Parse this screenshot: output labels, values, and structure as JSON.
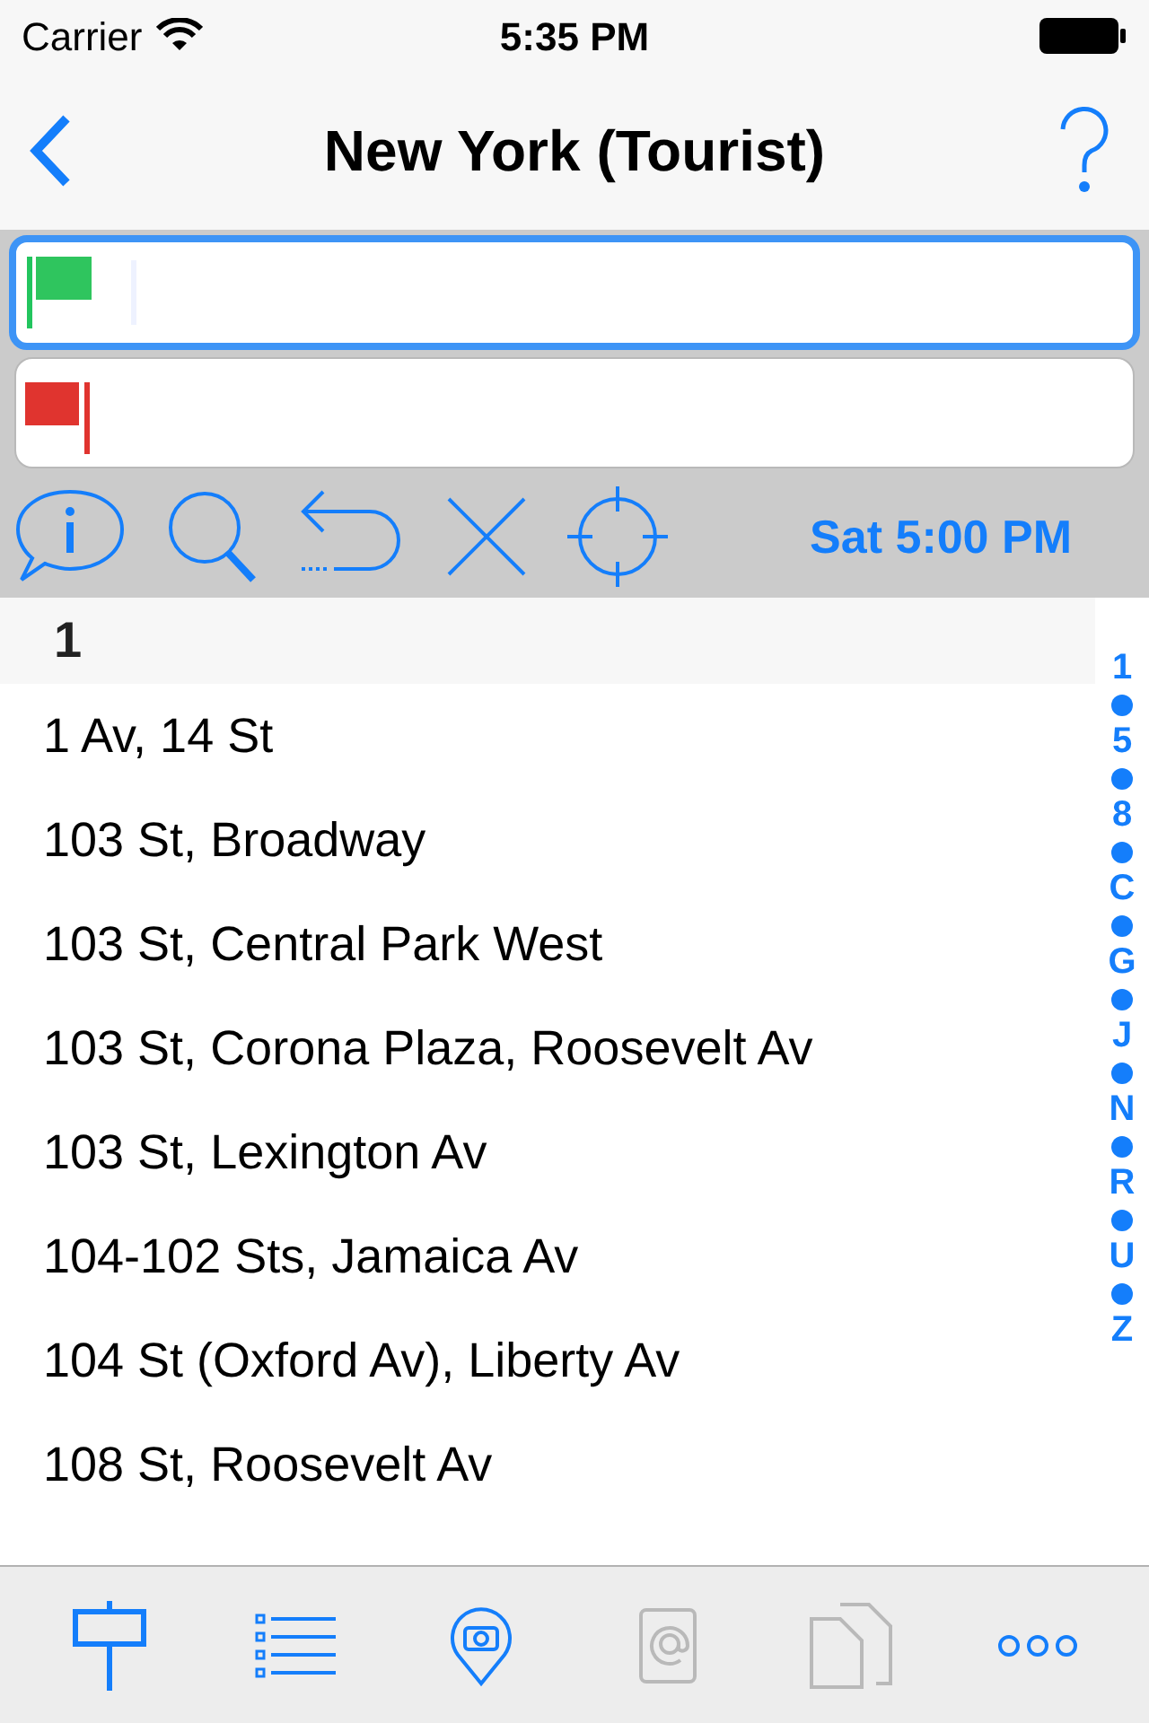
{
  "status_bar": {
    "carrier": "Carrier",
    "time": "5:35 PM"
  },
  "nav": {
    "title": "New York (Tourist)"
  },
  "fields": [
    {
      "kind": "start",
      "focused": true
    },
    {
      "kind": "end",
      "focused": false
    }
  ],
  "toolbar": {
    "time": "Sat 5:00 PM"
  },
  "section": {
    "title": "1"
  },
  "rows": [
    "1 Av, 14 St",
    "103 St, Broadway",
    "103 St, Central Park West",
    "103 St, Corona Plaza, Roosevelt Av",
    "103 St, Lexington Av",
    "104-102 Sts, Jamaica Av",
    "104 St (Oxford Av), Liberty Av",
    "108 St, Roosevelt Av"
  ],
  "index": [
    "1",
    "5",
    "8",
    "C",
    "G",
    "J",
    "N",
    "R",
    "U",
    "Z"
  ],
  "tabs": [
    {
      "kind": "stop",
      "disabled": false
    },
    {
      "kind": "list",
      "disabled": false
    },
    {
      "kind": "places",
      "disabled": false
    },
    {
      "kind": "contacts",
      "disabled": true
    },
    {
      "kind": "documents",
      "disabled": true
    },
    {
      "kind": "more",
      "disabled": false
    }
  ]
}
